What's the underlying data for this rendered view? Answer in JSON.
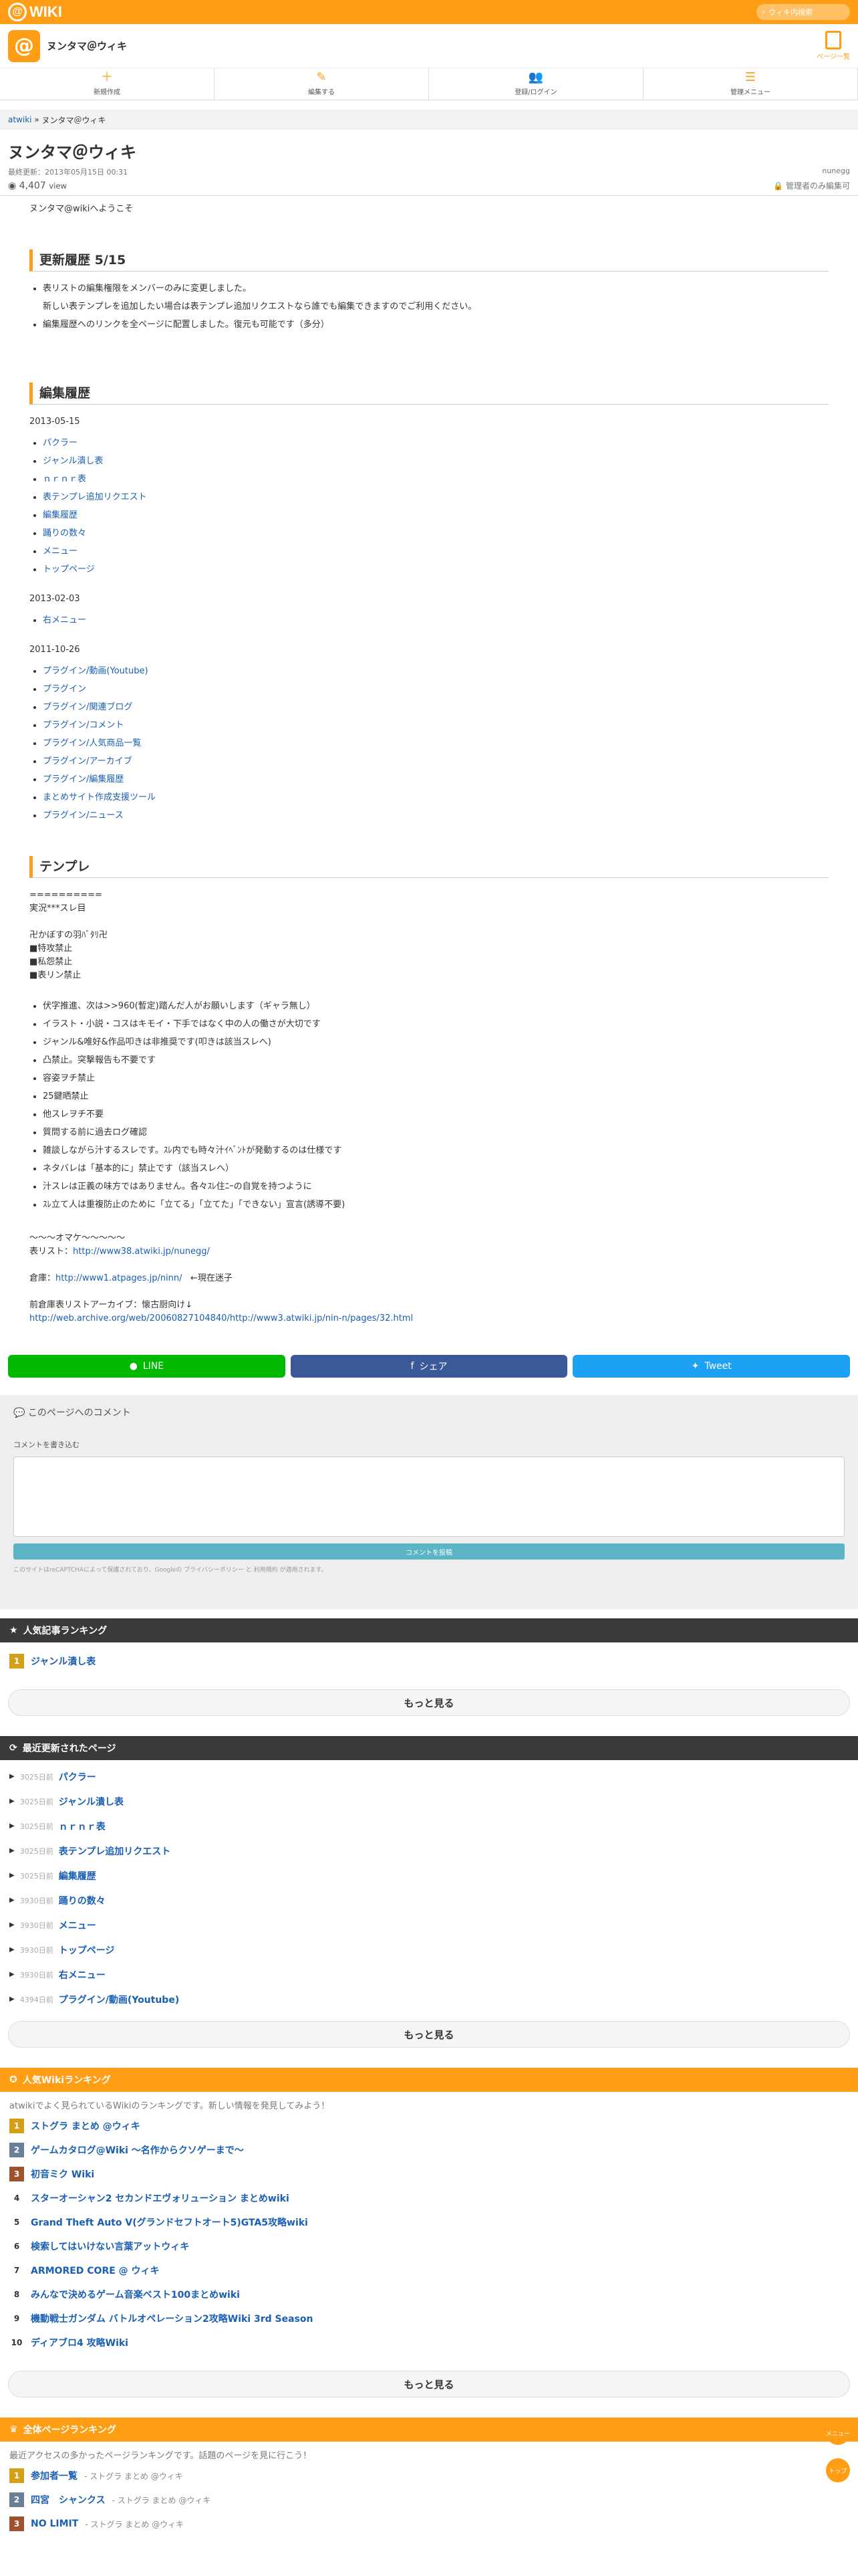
{
  "header": {
    "logo": "WIKI",
    "search_placeholder": "ウィキ内検索",
    "wiki_name": "ヌンタマ＠ウィキ",
    "page_list": "ページ一覧"
  },
  "actions": [
    {
      "label": "新規作成",
      "icon": "＋"
    },
    {
      "label": "編集する",
      "icon": "✎"
    },
    {
      "label": "登録/ログイン",
      "icon": "👥"
    },
    {
      "label": "管理メニュー",
      "icon": "☰"
    }
  ],
  "breadcrumb": {
    "root": "atwiki",
    "current": "ヌンタマ＠ウィキ"
  },
  "page": {
    "title": "ヌンタマ＠ウィキ",
    "updated": "最終更新：2013年05月15日 00:31",
    "author": "nunegg",
    "views": "4,407",
    "views_unit": "view",
    "admin_edit": "管理者のみ編集可",
    "welcome": "ヌンタマ@wikiへようこそ"
  },
  "sec1": {
    "title": "更新履歴 5/15",
    "items": [
      "表リストの編集権限をメンバーのみに変更しました。",
      "新しい表テンプレを追加したい場合は表テンプレ追加リクエストなら誰でも編集できますのでご利用ください。",
      "編集履歴へのリンクを全ページに配置しました。復元も可能です（多分）"
    ]
  },
  "sec2": {
    "title": "編集履歴",
    "d1": "2013-05-15",
    "l1": [
      "パクラー",
      "ジャンル潰し表",
      "ｎｒｎｒ表",
      "表テンプレ追加リクエスト",
      "編集履歴",
      "踊りの数々",
      "メニュー",
      "トップページ"
    ],
    "d2": "2013-02-03",
    "l2": [
      "右メニュー"
    ],
    "d3": "2011-10-26",
    "l3": [
      "プラグイン/動画(Youtube)",
      "プラグイン",
      "プラグイン/関連ブログ",
      "プラグイン/コメント",
      "プラグイン/人気商品一覧",
      "プラグイン/アーカイブ",
      "プラグイン/編集履歴",
      "まとめサイト作成支援ツール",
      "プラグイン/ニュース"
    ]
  },
  "sec3": {
    "title": "テンプレ",
    "lines": [
      "==========",
      "実況***スレ目",
      "",
      "卍かぼすの羽ﾊﾞﾀﾘ卍",
      "■特攻禁止",
      "■私怨禁止",
      "■表リン禁止"
    ],
    "rules": [
      "伏字推進、次は>>960(暫定)踏んだ人がお願いします（ギャラ無し）",
      "イラスト・小説・コスはキモイ・下手ではなく中の人の働さが大切です",
      "ジャンル&唯好&作品叩きは非推奨です(叩きは該当スレへ)",
      "凸禁止。突撃報告も不要です",
      "容姿ヲチ禁止",
      "25鍵晒禁止",
      "他スレヲチ不要",
      "質問する前に過去ログ確認",
      "雑談しながら汁するスレです。ｽﾚ内でも時々汁ｲﾍﾞﾝﾄが発動するのは仕様です",
      "ネタバレは「基本的に」禁止です（該当スレへ）",
      "汁スレは正義の味方ではありません。各々ｽﾚ住ﾆｰの自覚を持つように",
      "ｽﾚ立て人は重複防止のために「立てる」「立てた」「できない」宣言(誘導不要)"
    ],
    "omake": "〜〜〜オマケ〜〜〜〜〜",
    "link1_label": "表リスト：",
    "link1": "http://www38.atwiki.jp/nunegg/",
    "link2_label": "倉庫：",
    "link2": "http://www1.atpages.jp/ninn/",
    "link2_note": "←現在迷子",
    "link3_label": "前倉庫表リストアーカイブ：懐古厨向け↓",
    "link3": "http://web.archive.org/web/20060827104840/http://www3.atwiki.jp/nin-n/pages/32.html"
  },
  "share": {
    "line": "LINE",
    "facebook": "シェア",
    "twitter": "Tweet",
    "line_color": "#00b900",
    "fb_color": "#3b5998",
    "tw_color": "#1da1f2"
  },
  "comment": {
    "title": "このページへのコメント",
    "label": "コメントを書き込む",
    "submit": "コメントを投稿",
    "recaptcha": "このサイトはreCAPTCHAによって保護されており、Googleの プライバシーポリシー と 利用規約 が適用されます。"
  },
  "popular": {
    "title": "人気記事ランキング",
    "items": [
      "ジャンル潰し表"
    ],
    "more": "もっと見る"
  },
  "recent": {
    "title": "最近更新されたページ",
    "items": [
      {
        "date": "3025日前",
        "name": "パクラー"
      },
      {
        "date": "3025日前",
        "name": "ジャンル潰し表"
      },
      {
        "date": "3025日前",
        "name": "ｎｒｎｒ表"
      },
      {
        "date": "3025日前",
        "name": "表テンプレ追加リクエスト"
      },
      {
        "date": "3025日前",
        "name": "編集履歴"
      },
      {
        "date": "3930日前",
        "name": "踊りの数々"
      },
      {
        "date": "3930日前",
        "name": "メニュー"
      },
      {
        "date": "3930日前",
        "name": "トップページ"
      },
      {
        "date": "3930日前",
        "name": "右メニュー"
      },
      {
        "date": "4394日前",
        "name": "プラグイン/動画(Youtube)"
      }
    ],
    "more": "もっと見る"
  },
  "wikirank": {
    "title": "人気Wikiランキング",
    "desc": "atwikiでよく見られているWikiのランキングです。新しい情報を発見してみよう！",
    "items": [
      "ストグラ まとめ @ウィキ",
      "ゲームカタログ@Wiki ～名作からクソゲーまで～",
      "初音ミク Wiki",
      "スターオーシャン2 セカンドエヴォリューション まとめwiki",
      "Grand Theft Auto V(グランドセフトオート5)GTA5攻略wiki",
      "検索してはいけない言葉アットウィキ",
      "ARMORED CORE @ ウィキ",
      "みんなで決めるゲーム音楽ベスト100まとめwiki",
      "機動戦士ガンダム バトルオペレーション2攻略Wiki 3rd Season",
      "ディアブロ4 攻略Wiki"
    ],
    "more": "もっと見る"
  },
  "allrank": {
    "title": "全体ページランキング",
    "desc": "最近アクセスの多かったページランキングです。話題のページを見に行こう！",
    "items": [
      {
        "name": "参加者一覧",
        "wiki": "- ストグラ まとめ @ウィキ"
      },
      {
        "name": "四宮　シャンクス",
        "wiki": "- ストグラ まとめ @ウィキ"
      },
      {
        "name": "NO LIMIT",
        "wiki": "- ストグラ まとめ @ウィキ"
      }
    ]
  },
  "float": {
    "menu": "メニュー",
    "top": "トップ"
  }
}
